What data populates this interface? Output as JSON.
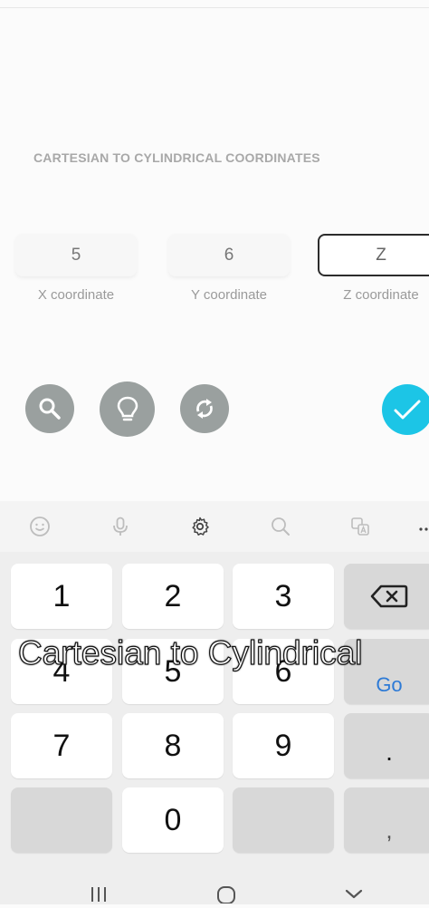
{
  "heading": "CARTESIAN TO CYLINDRICAL COORDINATES",
  "fields": [
    {
      "value": "5",
      "label": "X coordinate"
    },
    {
      "value": "6",
      "label": "Y coordinate"
    },
    {
      "value": "Z",
      "label": "Z coordinate"
    }
  ],
  "actions": {
    "search": "search-icon",
    "hint": "lightbulb-icon",
    "refresh": "refresh-icon",
    "submit": "check-icon"
  },
  "keyboard": {
    "rows": [
      [
        "1",
        "2",
        "3"
      ],
      [
        "4",
        "5",
        "6"
      ],
      [
        "7",
        "8",
        "9"
      ],
      [
        "",
        "0",
        ""
      ]
    ],
    "go_label": "Go",
    "dot_label": ".",
    "comma_label": ","
  },
  "overlay_caption": "Cartesian to Cylindrical",
  "colors": {
    "accent": "#1cc5e6",
    "button_grey": "#9aa09f",
    "go_blue": "#2d7ad6"
  }
}
